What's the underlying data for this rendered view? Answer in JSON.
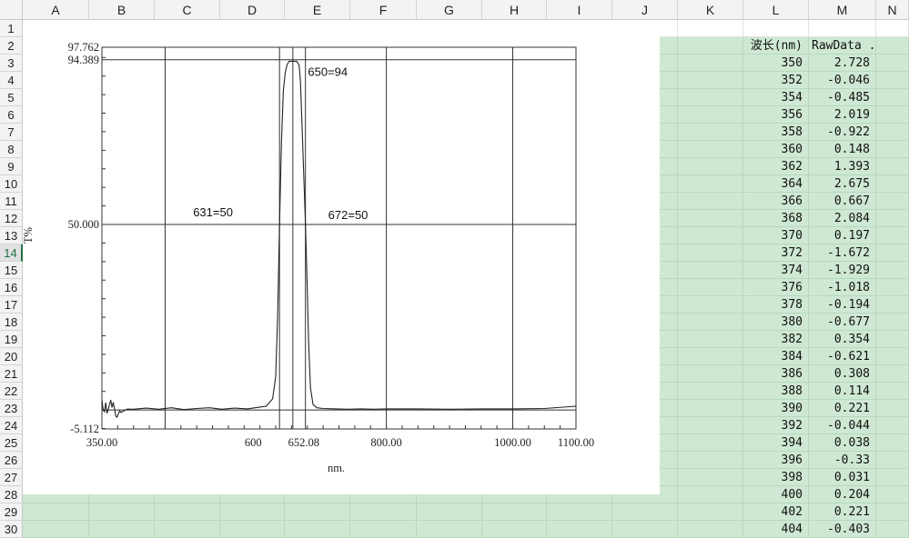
{
  "spreadsheet": {
    "columns": [
      "A",
      "B",
      "C",
      "D",
      "E",
      "F",
      "G",
      "H",
      "I",
      "J",
      "K",
      "L",
      "M",
      "N"
    ],
    "rows": [
      1,
      2,
      3,
      4,
      5,
      6,
      7,
      8,
      9,
      10,
      11,
      12,
      13,
      14,
      15,
      16,
      17,
      18,
      19,
      20,
      21,
      22,
      23,
      24,
      25,
      26,
      27,
      28,
      29,
      30
    ],
    "selected_row": 14,
    "headers": {
      "wavelength": "波长(nm)",
      "raw": "RawData ..."
    },
    "data": [
      [
        "350",
        "2.728"
      ],
      [
        "352",
        "-0.046"
      ],
      [
        "354",
        "-0.485"
      ],
      [
        "356",
        "2.019"
      ],
      [
        "358",
        "-0.922"
      ],
      [
        "360",
        "0.148"
      ],
      [
        "362",
        "1.393"
      ],
      [
        "364",
        "2.675"
      ],
      [
        "366",
        "0.667"
      ],
      [
        "368",
        "2.084"
      ],
      [
        "370",
        "0.197"
      ],
      [
        "372",
        "-1.672"
      ],
      [
        "374",
        "-1.929"
      ],
      [
        "376",
        "-1.018"
      ],
      [
        "378",
        "-0.194"
      ],
      [
        "380",
        "-0.677"
      ],
      [
        "382",
        "0.354"
      ],
      [
        "384",
        "-0.621"
      ],
      [
        "386",
        "0.308"
      ],
      [
        "388",
        "0.114"
      ],
      [
        "390",
        "0.221"
      ],
      [
        "392",
        "-0.044"
      ],
      [
        "394",
        "0.038"
      ],
      [
        "396",
        "-0.33"
      ],
      [
        "398",
        "0.031"
      ],
      [
        "400",
        "0.204"
      ],
      [
        "402",
        "0.221"
      ],
      [
        "404",
        "-0.403"
      ]
    ],
    "fill_color": "#cfe8d3"
  },
  "chart_data": {
    "type": "line",
    "ylabel": "T%",
    "xlabel": "nm.",
    "xlim": [
      350,
      1100
    ],
    "ylim": [
      -5.112,
      97.762
    ],
    "x_tick_labels": [
      "350.00",
      "600",
      "652.08",
      "800.00",
      "1000.00",
      "1100.00"
    ],
    "x_tick_values": [
      350,
      600,
      652.08,
      800,
      1000,
      1100
    ],
    "y_tick_labels": [
      "97.762",
      "94.389",
      "50.000",
      "-5.112"
    ],
    "y_tick_values": [
      97.762,
      94.389,
      50,
      -5.112
    ],
    "annotations": [
      {
        "text": "650=94",
        "x": 650,
        "y": 94
      },
      {
        "text": "631=50",
        "x": 631,
        "y": 50
      },
      {
        "text": "672=50",
        "x": 672,
        "y": 50
      }
    ],
    "reference_lines": {
      "x": [
        631,
        652.08,
        672
      ],
      "y": [
        94.389,
        50,
        0
      ]
    },
    "series": [
      {
        "x": [
          350,
          352,
          354,
          356,
          358,
          360,
          362,
          364,
          366,
          368,
          370,
          372,
          374,
          376,
          378,
          380,
          390,
          400,
          420,
          440,
          460,
          480,
          500,
          520,
          540,
          560,
          580,
          600,
          610,
          620,
          625,
          628,
          631,
          634,
          637,
          640,
          643,
          646,
          650,
          654,
          658,
          662,
          664,
          667,
          670,
          672,
          674,
          677,
          680,
          684,
          690,
          700,
          720,
          740,
          760,
          780,
          800,
          850,
          900,
          950,
          1000,
          1050,
          1100
        ],
        "y": [
          2.728,
          -0.046,
          -0.485,
          2.019,
          -0.922,
          0.148,
          1.393,
          2.675,
          0.667,
          2.084,
          0.197,
          -1.672,
          -1.929,
          -1.018,
          -0.194,
          -0.677,
          0.221,
          0.204,
          0.5,
          0.2,
          0.6,
          0.1,
          0.4,
          0.6,
          0.2,
          0.5,
          0.3,
          0.8,
          1.0,
          3,
          9,
          25,
          50,
          72,
          86,
          91,
          93,
          94,
          94,
          94,
          94,
          93,
          89,
          75,
          60,
          50,
          38,
          18,
          6,
          1.5,
          0.6,
          0.4,
          0.3,
          0.2,
          0.3,
          0.2,
          0.3,
          0.3,
          0.2,
          0.3,
          0.3,
          0.4,
          1.0
        ]
      }
    ]
  }
}
